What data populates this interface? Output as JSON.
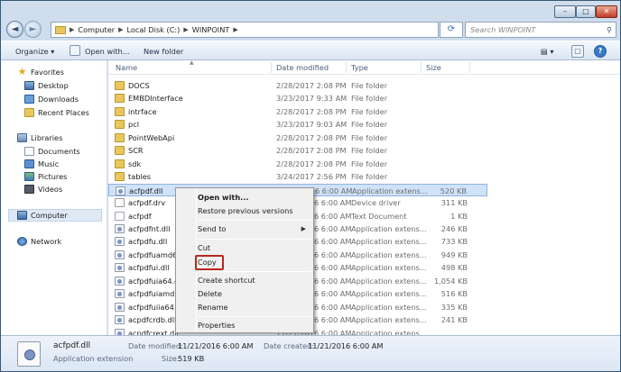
{
  "window": {
    "buttons": {
      "minimize": "–",
      "maximize": "□",
      "close": "✕"
    }
  },
  "nav": {
    "back_symbol": "◄",
    "forward_symbol": "►",
    "breadcrumbs": [
      "Computer",
      "Local Disk (C:)",
      "WINPOINT"
    ],
    "refresh_symbol": "⟳",
    "search_placeholder": "Search WINPOINT",
    "search_symbol": "⚲"
  },
  "toolbar": {
    "organize": "Organize ▾",
    "open_with": "Open with...",
    "new_folder": "New folder",
    "view_symbol": "▤ ▾",
    "preview_symbol": "▢",
    "help_symbol": "?"
  },
  "sidebar": {
    "favorites": "Favorites",
    "fav_items": [
      "Desktop",
      "Downloads",
      "Recent Places"
    ],
    "libraries": "Libraries",
    "lib_items": [
      "Documents",
      "Music",
      "Pictures",
      "Videos"
    ],
    "computer": "Computer",
    "network": "Network"
  },
  "columns": {
    "name": "Name",
    "date": "Date modified",
    "type": "Type",
    "size": "Size"
  },
  "files": [
    {
      "name": "DOCS",
      "date": "2/28/2017 2:08 PM",
      "type": "File folder",
      "size": "",
      "icon": "folder"
    },
    {
      "name": "EMBDInterface",
      "date": "3/23/2017 9:33 AM",
      "type": "File folder",
      "size": "",
      "icon": "folder"
    },
    {
      "name": "intrface",
      "date": "2/28/2017 2:08 PM",
      "type": "File folder",
      "size": "",
      "icon": "folder"
    },
    {
      "name": "pcl",
      "date": "3/23/2017 9:03 AM",
      "type": "File folder",
      "size": "",
      "icon": "folder"
    },
    {
      "name": "PointWebApi",
      "date": "2/28/2017 2:08 PM",
      "type": "File folder",
      "size": "",
      "icon": "folder"
    },
    {
      "name": "SCR",
      "date": "2/28/2017 2:08 PM",
      "type": "File folder",
      "size": "",
      "icon": "folder"
    },
    {
      "name": "sdk",
      "date": "2/28/2017 2:08 PM",
      "type": "File folder",
      "size": "",
      "icon": "folder"
    },
    {
      "name": "tables",
      "date": "3/24/2017 2:56 PM",
      "type": "File folder",
      "size": "",
      "icon": "folder"
    },
    {
      "name": "acfpdf.dll",
      "date": "11/21/2016 6:00 AM",
      "type": "Application extens...",
      "size": "520 KB",
      "icon": "dll"
    },
    {
      "name": "acfpdf.drv",
      "date": "11/21/2016 6:00 AM",
      "type": "Device driver",
      "size": "311 KB",
      "icon": "drv"
    },
    {
      "name": "acfpdf",
      "date": "11/21/2016 6:00 AM",
      "type": "Text Document",
      "size": "1 KB",
      "icon": "txt"
    },
    {
      "name": "acfpdfnt.dll",
      "date": "11/21/2016 6:00 AM",
      "type": "Application extens...",
      "size": "246 KB",
      "icon": "dll"
    },
    {
      "name": "acfpdfu.dll",
      "date": "11/21/2016 6:00 AM",
      "type": "Application extens...",
      "size": "733 KB",
      "icon": "dll"
    },
    {
      "name": "acfpdfuamd64.dll",
      "date": "11/21/2016 6:00 AM",
      "type": "Application extens...",
      "size": "949 KB",
      "icon": "dll"
    },
    {
      "name": "acfpdfui.dll",
      "date": "11/21/2016 6:00 AM",
      "type": "Application extens...",
      "size": "498 KB",
      "icon": "dll"
    },
    {
      "name": "acfpdfuia64.dll",
      "date": "11/21/2016 6:00 AM",
      "type": "Application extens...",
      "size": "1,054 KB",
      "icon": "dll"
    },
    {
      "name": "acfpdfuiamd64.dll",
      "date": "11/21/2016 6:00 AM",
      "type": "Application extens...",
      "size": "516 KB",
      "icon": "dll"
    },
    {
      "name": "acfpdfuiia64.dll",
      "date": "11/21/2016 6:00 AM",
      "type": "Application extens...",
      "size": "335 KB",
      "icon": "dll"
    },
    {
      "name": "acpdfcrdb.dll",
      "date": "11/21/2016 6:00 AM",
      "type": "Application extens...",
      "size": "241 KB",
      "icon": "dll"
    },
    {
      "name": "acpdfcrext.dll",
      "date": "11/21/2016 6:00 AM",
      "type": "Application extens...",
      "size": "",
      "icon": "dll"
    }
  ],
  "context_menu": {
    "open_with": "Open with...",
    "restore": "Restore previous versions",
    "send_to": "Send to",
    "send_to_arrow": "▶",
    "cut": "Cut",
    "copy": "Copy",
    "create_shortcut": "Create shortcut",
    "delete": "Delete",
    "rename": "Rename",
    "properties": "Properties"
  },
  "details": {
    "filename": "acfpdf.dll",
    "filetype": "Application extension",
    "modified_label": "Date modified:",
    "modified_value": "11/21/2016 6:00 AM",
    "created_label": "Date created:",
    "created_value": "11/21/2016 6:00 AM",
    "size_label": "Size:",
    "size_value": "519 KB"
  }
}
